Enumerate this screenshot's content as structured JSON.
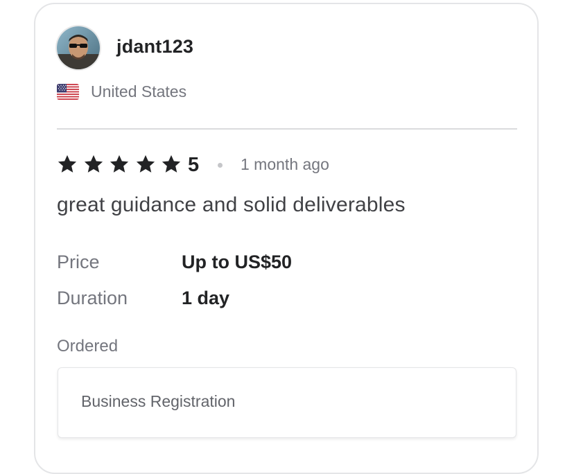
{
  "reviewer": {
    "username": "jdant123",
    "country": "United States",
    "flag_icon": "us-flag-icon"
  },
  "review": {
    "stars": 5,
    "rating_label": "5",
    "time_ago": "1 month ago",
    "text": "great guidance and solid deliverables"
  },
  "details": {
    "price_label": "Price",
    "price_value": "Up to US$50",
    "duration_label": "Duration",
    "duration_value": "1 day"
  },
  "ordered": {
    "label": "Ordered",
    "item": "Business Registration"
  },
  "colors": {
    "text_primary": "#222325",
    "text_secondary": "#74767e",
    "divider": "#dadbdd",
    "star": "#222325"
  }
}
